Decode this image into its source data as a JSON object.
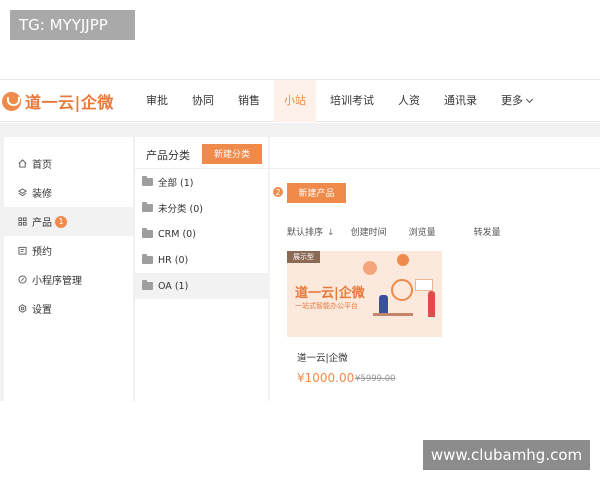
{
  "watermarks": {
    "top": "TG: MYYJJPP",
    "bottom": "www.clubamhg.com"
  },
  "header": {
    "logo_text": "道一云|企微",
    "nav": [
      {
        "label": "审批"
      },
      {
        "label": "协同"
      },
      {
        "label": "销售"
      },
      {
        "label": "小站",
        "active": true
      },
      {
        "label": "培训考试"
      },
      {
        "label": "人资"
      },
      {
        "label": "通讯录"
      },
      {
        "label": "更多"
      }
    ]
  },
  "sidebar": {
    "items": [
      {
        "label": "首页",
        "icon": "home-icon"
      },
      {
        "label": "装修",
        "icon": "layers-icon"
      },
      {
        "label": "产品",
        "icon": "grid-icon",
        "active": true,
        "badge": "1"
      },
      {
        "label": "预约",
        "icon": "calendar-icon"
      },
      {
        "label": "小程序管理",
        "icon": "compass-icon"
      },
      {
        "label": "设置",
        "icon": "settings-icon"
      }
    ]
  },
  "categories": {
    "title": "产品分类",
    "new_button": "新建分类",
    "items": [
      {
        "label": "全部 (1)"
      },
      {
        "label": "未分类 (0)"
      },
      {
        "label": "CRM (0)"
      },
      {
        "label": "HR (0)"
      },
      {
        "label": "OA (1)",
        "active": true
      }
    ]
  },
  "content": {
    "step_badge": "2",
    "new_product_button": "新建产品",
    "sort_options": [
      {
        "label": "默认排序",
        "arrow": "↓"
      },
      {
        "label": "创建时间"
      },
      {
        "label": "浏览量"
      },
      {
        "label": "转发量"
      }
    ],
    "product": {
      "tag": "展示型",
      "banner_title": "道一云|企微",
      "banner_subtitle": "一站式智能办公平台",
      "name": "道一云|企微",
      "price": "¥1000.00",
      "old_price": "¥5999.00"
    }
  },
  "colors": {
    "accent": "#f08a4b",
    "background": "#f2f2f2"
  }
}
